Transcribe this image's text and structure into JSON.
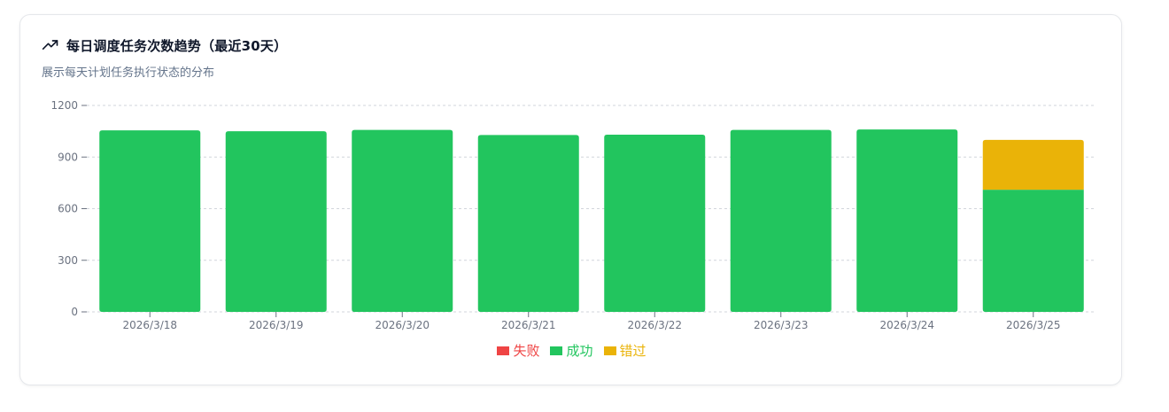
{
  "card": {
    "title": "每日调度任务次数趋势（最近30天）",
    "subtitle": "展示每天计划任务执行状态的分布",
    "title_icon": "trending-up-icon"
  },
  "colors": {
    "failed": "#ef4444",
    "success": "#22c55e",
    "skipped": "#eab308",
    "grid": "#d1d5db",
    "tick": "#6b7280"
  },
  "chart_data": {
    "type": "bar",
    "stacked": true,
    "categories": [
      "2026/3/18",
      "2026/3/19",
      "2026/3/20",
      "2026/3/21",
      "2026/3/22",
      "2026/3/23",
      "2026/3/24",
      "2026/3/25"
    ],
    "series": [
      {
        "name": "失败",
        "key": "failed",
        "values": [
          0,
          0,
          0,
          0,
          0,
          0,
          0,
          0
        ]
      },
      {
        "name": "成功",
        "key": "success",
        "values": [
          1055,
          1050,
          1058,
          1028,
          1030,
          1058,
          1060,
          710
        ]
      },
      {
        "name": "错过",
        "key": "skipped",
        "values": [
          0,
          0,
          0,
          0,
          0,
          0,
          0,
          290
        ]
      }
    ],
    "yticks": [
      0,
      300,
      600,
      900,
      1200
    ],
    "ylim": [
      0,
      1200
    ],
    "grid": true,
    "legend_position": "bottom-center"
  }
}
